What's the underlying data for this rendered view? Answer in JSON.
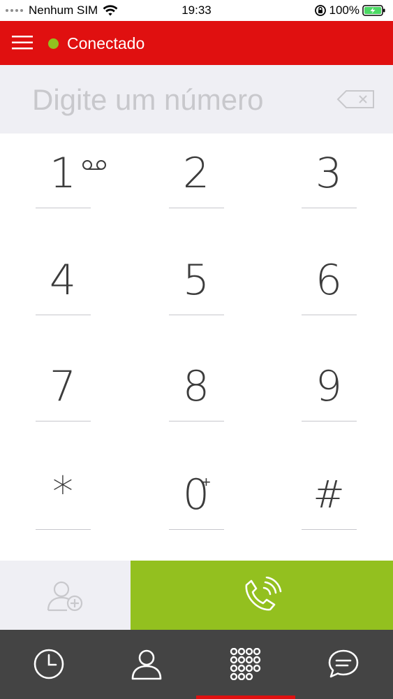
{
  "status_bar": {
    "carrier": "Nenhum SIM",
    "time": "19:33",
    "battery": "100%"
  },
  "header": {
    "status_label": "Conectado",
    "status_color": "#92c01f",
    "brand_color": "#e01010"
  },
  "dialer": {
    "placeholder": "Digite um número"
  },
  "keypad": {
    "keys": [
      {
        "digit": "1",
        "sub": "voicemail-icon"
      },
      {
        "digit": "2"
      },
      {
        "digit": "3"
      },
      {
        "digit": "4"
      },
      {
        "digit": "5"
      },
      {
        "digit": "6"
      },
      {
        "digit": "7"
      },
      {
        "digit": "8"
      },
      {
        "digit": "9"
      },
      {
        "digit": "*"
      },
      {
        "digit": "0",
        "sub": "+"
      },
      {
        "digit": "#"
      }
    ]
  },
  "actions": {
    "add_contact_icon": "add-contact-icon",
    "call_icon": "phone-call-icon",
    "call_color": "#93c01f"
  },
  "tabs": [
    {
      "name": "history",
      "icon": "clock-icon"
    },
    {
      "name": "contacts",
      "icon": "person-icon"
    },
    {
      "name": "keypad",
      "icon": "keypad-icon",
      "active": true
    },
    {
      "name": "messages",
      "icon": "chat-icon"
    }
  ]
}
